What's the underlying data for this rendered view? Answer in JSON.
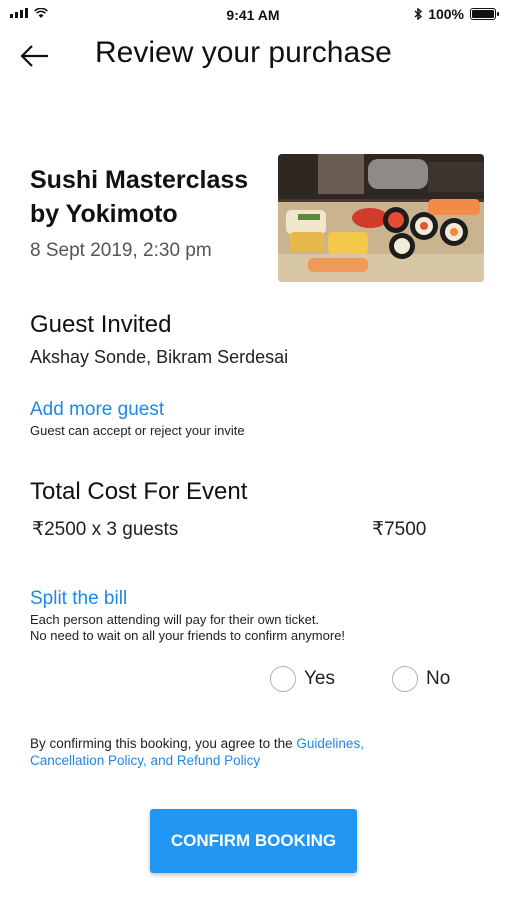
{
  "status_bar": {
    "time": "9:41 AM",
    "battery_percent": "100%",
    "battery_level": 1.0
  },
  "header": {
    "title": "Review your purchase",
    "back_icon": "back-arrow-icon"
  },
  "event": {
    "title": "Sushi Masterclass by Yokimoto",
    "datetime": "8 Sept 2019, 2:30 pm",
    "image": "sushi-photo"
  },
  "guests": {
    "heading": "Guest Invited",
    "names": "Akshay Sonde, Bikram Serdesai",
    "add_link": "Add more guest",
    "note": "Guest can accept or reject your invite"
  },
  "cost": {
    "heading": "Total Cost For Event",
    "line": "₹2500 x 3 guests",
    "total": "₹7500"
  },
  "split": {
    "link": "Split the bill",
    "note_line1": "Each person attending will pay for their own ticket.",
    "note_line2": "No need to wait on all your friends to confirm anymore!",
    "options": [
      {
        "label": "Yes",
        "selected": false
      },
      {
        "label": "No",
        "selected": false
      }
    ]
  },
  "terms": {
    "prefix": "By confirming this booking, you agree to the ",
    "guidelines": "Guidelines,",
    "policies": "Cancellation Policy, and Refund Policy"
  },
  "confirm_button": "CONFIRM BOOKING",
  "colors": {
    "accent": "#2196f3",
    "link": "#1e88e5",
    "text": "#111111"
  }
}
